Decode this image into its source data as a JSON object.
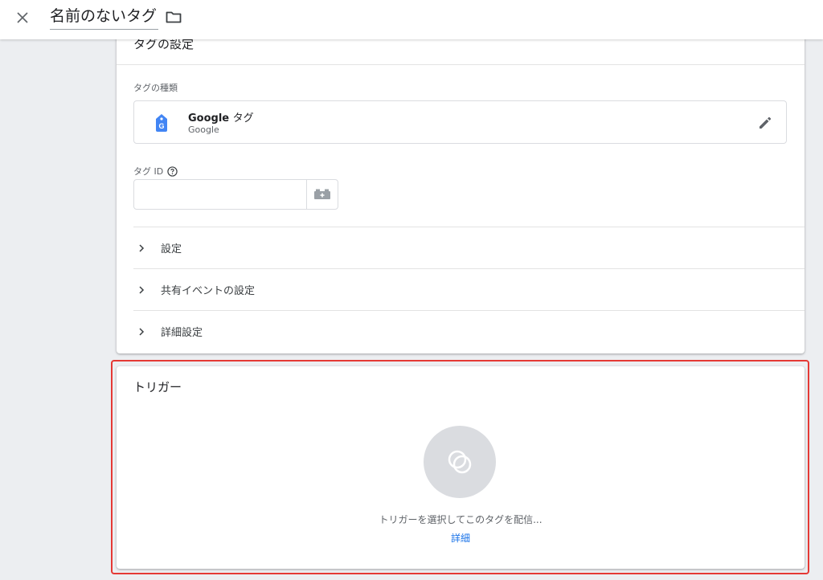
{
  "header": {
    "title": "名前のないタグ",
    "close_icon": "close-icon",
    "folder_icon": "folder-icon"
  },
  "tag_config": {
    "heading": "タグの設定",
    "tag_type_label": "タグの種類",
    "tag_type": {
      "name": "Google",
      "name_suffix": "タグ",
      "vendor": "Google",
      "icon": "google-tag-icon",
      "edit_icon": "pencil-icon"
    },
    "tag_id": {
      "label": "タグ ID",
      "help_icon": "help-icon",
      "value": "",
      "placeholder": "",
      "variable_icon": "variable-picker-icon"
    },
    "sections": [
      {
        "label": "設定"
      },
      {
        "label": "共有イベントの設定"
      },
      {
        "label": "詳細設定"
      }
    ]
  },
  "triggering": {
    "heading": "トリガー",
    "message": "トリガーを選択してこのタグを配信...",
    "link": "詳細",
    "icon": "trigger-icon"
  },
  "colors": {
    "accent": "#1a73e8",
    "highlight_border": "#e53935",
    "google_tag_blue": "#4285f4"
  }
}
